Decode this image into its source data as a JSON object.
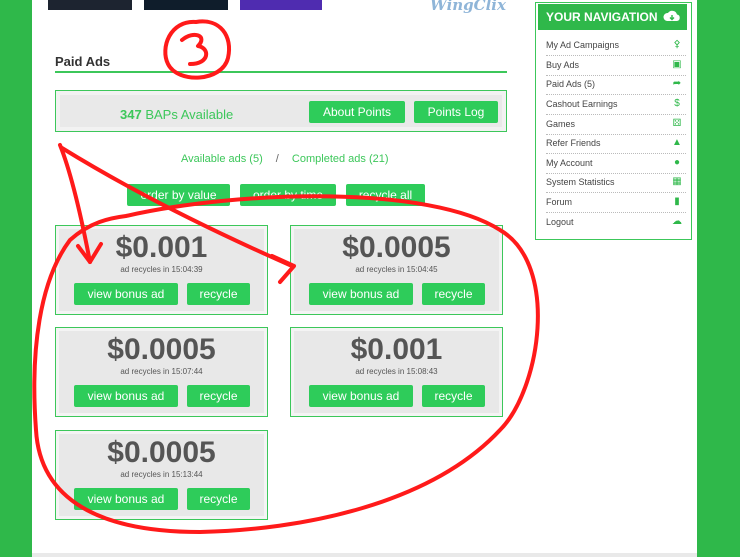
{
  "banner": {
    "brand_text": "WingClix"
  },
  "section_title": "Paid Ads",
  "points": {
    "count": "347",
    "label": "BAPs Available",
    "about_button": "About Points",
    "log_button": "Points Log"
  },
  "ad_links": {
    "available": "Available ads (5)",
    "separator": "/",
    "completed": "Completed ads (21)"
  },
  "sort_buttons": {
    "by_value": "order by value",
    "by_time": "order by time",
    "recycle_all": "recycle all"
  },
  "ads": [
    {
      "price": "$0.001",
      "recycle_text": "ad recycles in 15:04:39",
      "view_label": "view bonus ad",
      "recycle_label": "recycle"
    },
    {
      "price": "$0.0005",
      "recycle_text": "ad recycles in 15:04:45",
      "view_label": "view bonus ad",
      "recycle_label": "recycle"
    },
    {
      "price": "$0.0005",
      "recycle_text": "ad recycles in 15:07:44",
      "view_label": "view bonus ad",
      "recycle_label": "recycle"
    },
    {
      "price": "$0.001",
      "recycle_text": "ad recycles in 15:08:43",
      "view_label": "view bonus ad",
      "recycle_label": "recycle"
    },
    {
      "price": "$0.0005",
      "recycle_text": "ad recycles in 15:13:44",
      "view_label": "view bonus ad",
      "recycle_label": "recycle"
    }
  ],
  "nav": {
    "title": "YOUR NAVIGATION",
    "title_icon": "cloud-download-icon",
    "items": [
      {
        "label": "My Ad Campaigns",
        "icon": "share-icon"
      },
      {
        "label": "Buy Ads",
        "icon": "window-icon"
      },
      {
        "label": "Paid Ads (5)",
        "icon": "forward-icon"
      },
      {
        "label": "Cashout Earnings",
        "icon": "money-icon"
      },
      {
        "label": "Games",
        "icon": "dice-icon"
      },
      {
        "label": "Refer Friends",
        "icon": "sitemap-icon"
      },
      {
        "label": "My Account",
        "icon": "user-icon"
      },
      {
        "label": "System Statistics",
        "icon": "stats-icon"
      },
      {
        "label": "Forum",
        "icon": "book-icon"
      },
      {
        "label": "Logout",
        "icon": "cloud-upload-icon"
      }
    ]
  },
  "annotation": {
    "number": "3",
    "color": "#ff1a1a"
  }
}
